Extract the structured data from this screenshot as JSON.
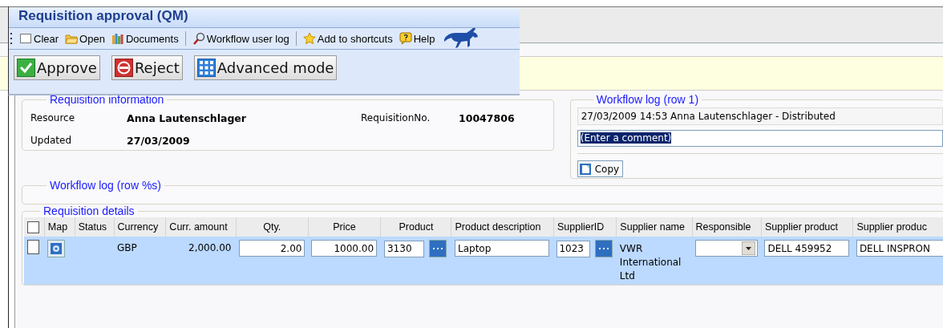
{
  "window": {
    "title": "Requisition approval (QM)"
  },
  "toolbar": [
    [
      {
        "kind": "clear",
        "label": "Clear"
      },
      {
        "kind": "open",
        "label": "Open"
      },
      {
        "kind": "documents",
        "label": "Documents"
      }
    ],
    [
      {
        "kind": "log",
        "label": "Workflow user log"
      }
    ],
    [
      {
        "kind": "shortcut",
        "label": "Add to shortcuts"
      },
      {
        "kind": "help",
        "label": "Help"
      }
    ]
  ],
  "actions": [
    {
      "kind": "approve",
      "label": "Approve"
    },
    {
      "kind": "reject",
      "label": "Reject"
    },
    {
      "kind": "advanced",
      "label": "Advanced mode"
    }
  ],
  "requisition_information": {
    "title": "Requisition information",
    "fields": [
      {
        "label": "Resource",
        "value": "Anna Lautenschlager"
      },
      {
        "label": "RequisitionNo.",
        "value": "10047806"
      },
      {
        "label": "Updated",
        "value": "27/03/2009"
      }
    ]
  },
  "workflow_log": {
    "title": "Workflow log (row 1)",
    "entry": "27/03/2009 14:53 Anna Lautenschlager - Distributed",
    "comment": {
      "value": "(Enter a comment)",
      "highlighted": true
    },
    "copy_button": "Copy"
  },
  "workflow_log_template": {
    "title": "Workflow log (row %s)"
  },
  "requisition_details": {
    "title": "Requisition details",
    "all_checked": false,
    "columns": [
      "Map",
      "Status",
      "Currency",
      "Curr. amount",
      "Qty.",
      "Price",
      "Product",
      "Product description",
      "SupplierID",
      "Supplier name",
      "Responsible",
      "Supplier product",
      "Supplier produc"
    ],
    "rows": [
      {
        "selected": true,
        "checked": false,
        "currency": "GBP",
        "amount": "2,000.00",
        "qty": "2.00",
        "price": "1000.00",
        "product": "3130",
        "product_description": "Laptop",
        "supplier_id": "1023",
        "supplier_name": "VWR International Ltd",
        "supplier_product": "DELL 459952",
        "supplier_product_2": "DELL INSPRON"
      }
    ]
  }
}
